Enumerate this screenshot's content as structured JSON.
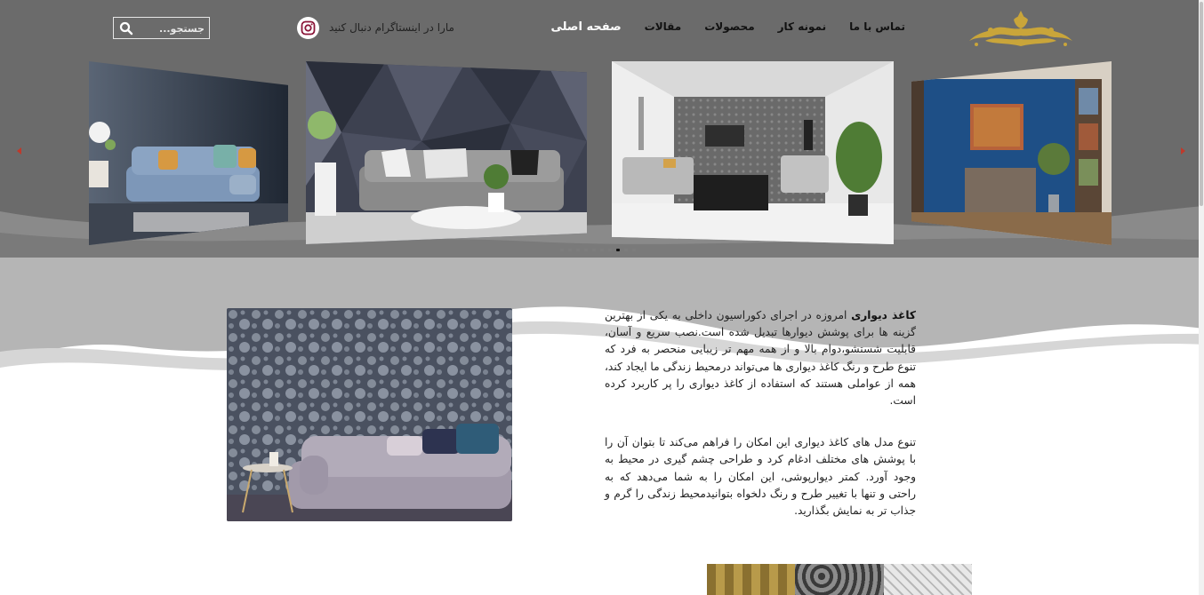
{
  "nav": {
    "items": [
      {
        "label": "صفحه اصلی",
        "active": true
      },
      {
        "label": "مقالات",
        "active": false
      },
      {
        "label": "محصولات",
        "active": false
      },
      {
        "label": "نمونه کار",
        "active": false
      },
      {
        "label": "تماس با ما",
        "active": false
      }
    ],
    "instagram_text": "مارا در اینستاگرام دنبال کنید",
    "instagram_icon": "instagram-icon",
    "search": {
      "placeholder": "جستجو...",
      "icon": "search-icon"
    }
  },
  "slider": {
    "slides": [
      "slide-blue-wall-room",
      "slide-modern-living-room",
      "slide-geometric-3d-wallpaper",
      "slide-grey-wall-sofa"
    ],
    "dot_count": 10,
    "active_dot": 8,
    "prev_icon": "chevron-left-icon",
    "next_icon": "chevron-right-icon"
  },
  "article": {
    "p1_bold": "کاغذ دیواری",
    "p1_text": " امروزه در اجرای دکوراسیون داخلی به یکی از بهترین گزینه ها برای پوشش دیوارها تبدیل شده است.نصب سریع و آسان، قابلیت شستشو،دوام بالا و از همه مهم تر زیبایی منحصر به فرد که تنوع طرح و رنگ کاغذ دیواری ها می‌تواند درمحیط زندگی ما ایجاد کند، همه از عواملی هستند که استفاده از کاغذ دیواری را پر کاربرد کرده است.",
    "p2_text": "تنوع مدل های کاغذ دیواری این امکان را فراهم می‌کند تا بتوان آن را با پوشش های مختلف ادغام کرد و طراحی چشم گیری در محیط به وجود آورد. کمتر دیوارپوشی، این امکان را به شما می‌دهد که به راحتی و تنها با تغییر طرح و رنگ دلخواه بتوانیدمحیط زندگی را گرم و جذاب تر  به نمایش بگذارید."
  },
  "colors": {
    "hero_bg": "#6b6b6b",
    "wave_light": "#c4c4c4",
    "wave_mid": "#a9a9a9",
    "logo_gold": "#c9a53a"
  }
}
